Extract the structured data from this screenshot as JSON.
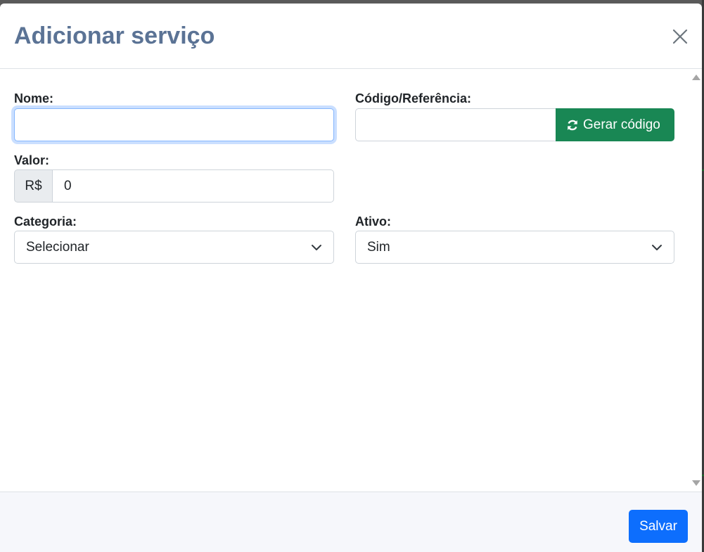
{
  "modal": {
    "title": "Adicionar serviço",
    "close_label": "Fechar"
  },
  "form": {
    "nome": {
      "label": "Nome:",
      "value": "",
      "placeholder": ""
    },
    "codigo": {
      "label": "Código/Referência:",
      "value": "",
      "placeholder": "",
      "generate_button": "Gerar código"
    },
    "valor": {
      "label": "Valor:",
      "prefix": "R$",
      "value": "0"
    },
    "categoria": {
      "label": "Categoria:",
      "selected": "Selecionar"
    },
    "ativo": {
      "label": "Ativo:",
      "selected": "Sim"
    }
  },
  "footer": {
    "save_label": "Salvar"
  },
  "colors": {
    "title": "#5b7395",
    "success": "#198754",
    "primary": "#0d6efd",
    "focus_border": "#86b7fe"
  },
  "icons": {
    "close": "close-icon",
    "refresh": "refresh-icon",
    "chevron": "chevron-down-icon"
  }
}
